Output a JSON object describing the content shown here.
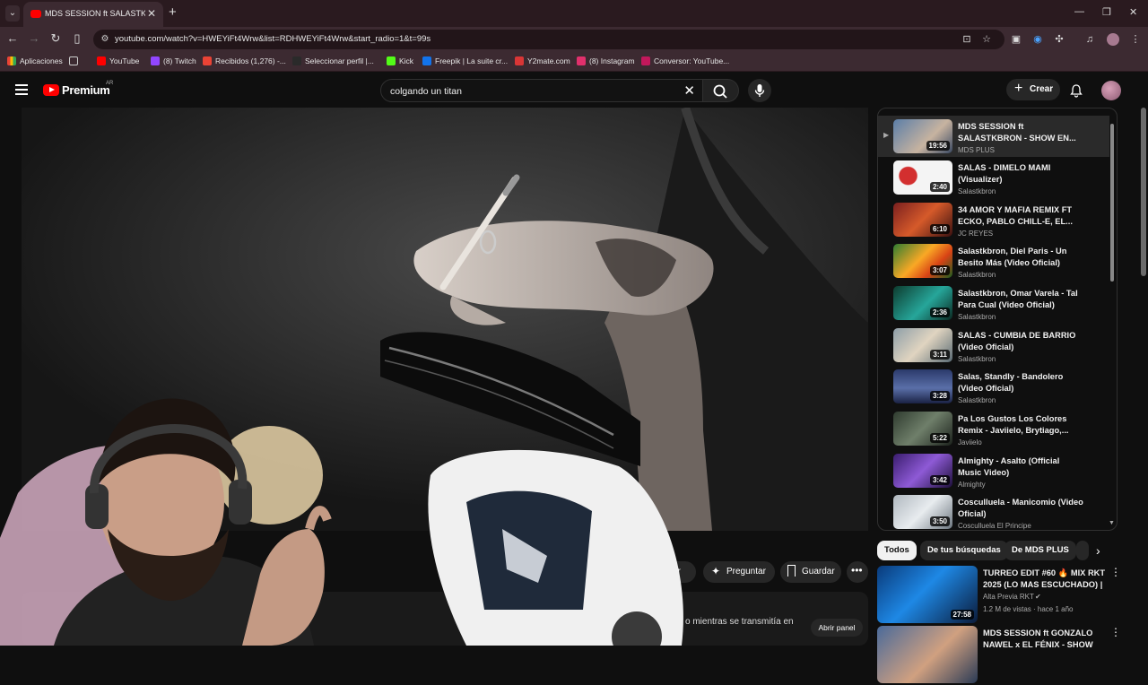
{
  "browser": {
    "tab_title": "MDS SESSION ft SALASTKBRON",
    "url": "youtube.com/watch?v=HWEYiFt4Wrw&list=RDHWEYiFt4Wrw&start_radio=1&t=99s",
    "bookmarks": [
      {
        "label": "Aplicaciones",
        "color": "#ea4335"
      },
      {
        "label": "YouTube",
        "color": "#ff0000"
      },
      {
        "label": "(8) Twitch",
        "color": "#9146ff"
      },
      {
        "label": "Recibidos (1,276) -...",
        "color": "#ea4335"
      },
      {
        "label": "Seleccionar perfil |...",
        "color": "#2a2a2a"
      },
      {
        "label": "Kick",
        "color": "#53fc18"
      },
      {
        "label": "Freepik | La suite cr...",
        "color": "#1273eb"
      },
      {
        "label": "Y2mate.com",
        "color": "#d93636"
      },
      {
        "label": "(8) Instagram",
        "color": "#e1306c"
      },
      {
        "label": "Conversor: YouTube...",
        "color": "#c2185b"
      }
    ]
  },
  "header": {
    "logo_text": "Premium",
    "region": "AR",
    "search_query": "colgando un titan",
    "create_label": "Crear"
  },
  "actions": {
    "share_label": "partir",
    "ask_label": "Preguntar",
    "save_label": "Guardar"
  },
  "chat": {
    "text": "o mientras se transmitía en",
    "open_label": "Abrir panel"
  },
  "playlist": [
    {
      "title": "MDS SESSION ft SALASTKBRON - SHOW EN...",
      "channel": "MDS PLUS",
      "duration": "19:56",
      "active": true
    },
    {
      "title": "SALAS - DIMELO MAMI (Visualizer)",
      "channel": "Salastkbron",
      "duration": "2:40"
    },
    {
      "title": "34 AMOR Y MAFIA REMIX FT ECKO, PABLO CHILL-E, EL...",
      "channel": "JC REYES",
      "duration": "6:10"
    },
    {
      "title": "Salastkbron, Diel Paris - Un Besito Más (Video Oficial)",
      "channel": "Salastkbron",
      "duration": "3:07"
    },
    {
      "title": "Salastkbron, Omar Varela - Tal Para Cual (Video Oficial)",
      "channel": "Salastkbron",
      "duration": "2:36"
    },
    {
      "title": "SALAS - CUMBIA DE BARRIO (Video Oficial)",
      "channel": "Salastkbron",
      "duration": "3:11"
    },
    {
      "title": "Salas, Standly - Bandolero (Video Oficial)",
      "channel": "Salastkbron",
      "duration": "3:28"
    },
    {
      "title": "Pa Los Gustos Los Colores Remix - Javiielo, Brytiago,...",
      "channel": "Javiielo",
      "duration": "5:22"
    },
    {
      "title": "Almighty - Asalto (Official Music Video)",
      "channel": "Almighty",
      "duration": "3:42"
    },
    {
      "title": "Cosculluela - Manicomio (Video Oficial)",
      "channel": "Cosculluela El Principe",
      "duration": "3:50"
    }
  ],
  "chips": [
    "Todos",
    "De tus búsquedas",
    "De MDS PLUS"
  ],
  "recommendations": [
    {
      "title": "TURREO EDIT #60 🔥 MIX RKT 2025 (LO MAS ESCUCHADO) | ...",
      "channel": "Alta Previa RKT",
      "meta": "1.2 M de vistas · hace 1 año",
      "duration": "27:58"
    },
    {
      "title": "MDS SESSION ft GONZALO NAWEL x EL FÉNIX - SHOW EN...",
      "channel": "",
      "meta": "",
      "duration": ""
    }
  ],
  "colors": {
    "accent": "#ff0000",
    "tab_bg": "#3c2a31",
    "page_bg": "#0f0f0f"
  }
}
